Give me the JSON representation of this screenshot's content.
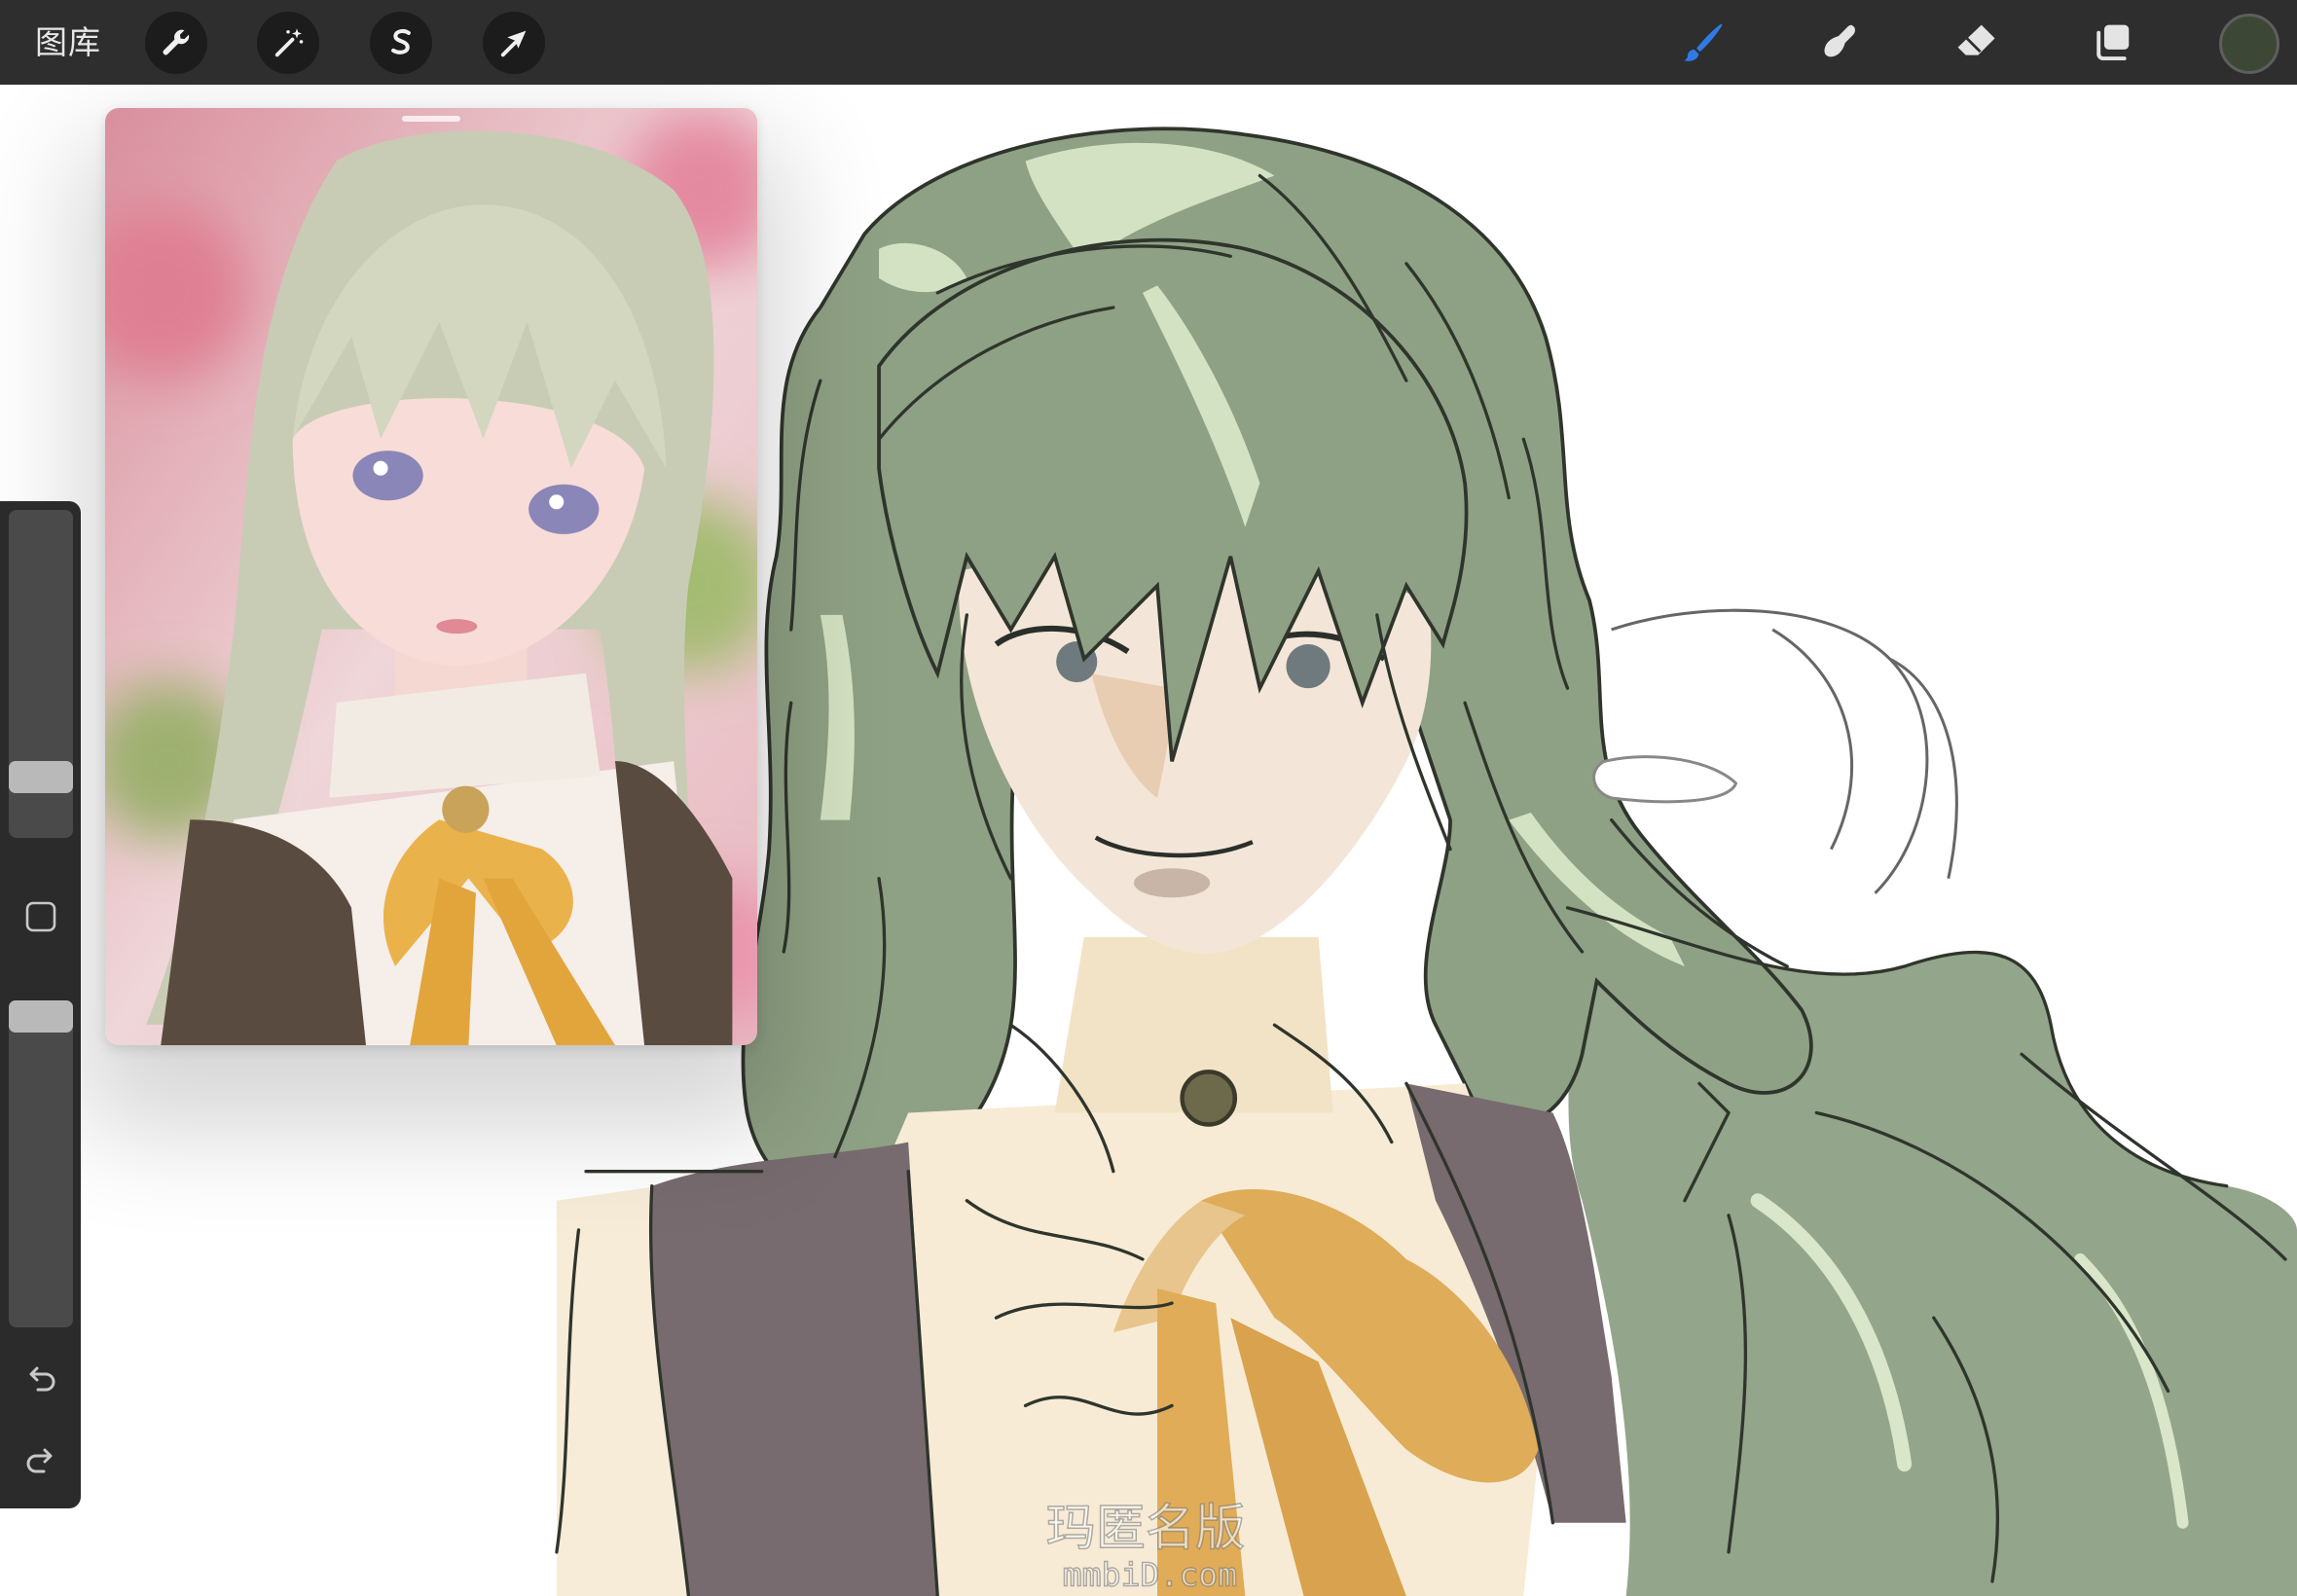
{
  "top_bar": {
    "gallery_label": "图库",
    "left_tools": [
      "wrench-icon",
      "magic-wand-icon",
      "selection-icon",
      "transform-arrow-icon"
    ],
    "right_tools": [
      "brush-icon",
      "smudge-icon",
      "eraser-icon",
      "layers-icon"
    ],
    "active_tool": "brush-icon",
    "current_color": "#3c4736"
  },
  "sidebar": {
    "brush_size": 0.15,
    "opacity": 1.0,
    "icons": [
      "modify-square-icon",
      "undo-icon",
      "redo-icon"
    ]
  },
  "colors": {
    "accent": "#2f7be6",
    "toolbar_bg": "#2e2e2e",
    "panel_bg": "#2b2b2b",
    "canvas_bg": "#ffffff"
  },
  "watermark": {
    "line1": "玛匿名版",
    "line2": "mmbiD.com"
  }
}
